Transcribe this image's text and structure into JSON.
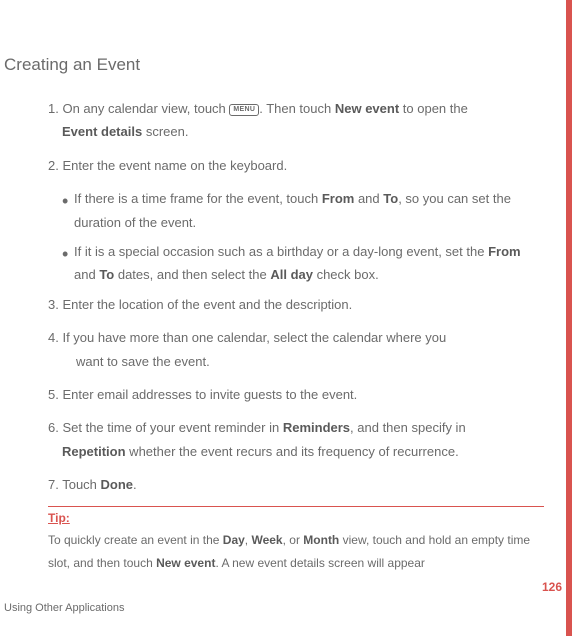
{
  "heading": "Creating an Event",
  "steps": {
    "s1_pre": "1. On any calendar view, touch ",
    "s1_menu": "MENU",
    "s1_mid": ". Then touch ",
    "s1_bold1": "New event",
    "s1_mid2": " to open the ",
    "s1_bold2": "Event details",
    "s1_end": " screen.",
    "s2": "2. Enter the event name on the keyboard.",
    "b1_pre": "If there is a time frame for the event, touch ",
    "b1_from": "From",
    "b1_and": " and ",
    "b1_to": "To",
    "b1_end": ", so you can set the duration of the event.",
    "b2_pre": "If it is a special occasion such as a birthday or a day-long event, set the ",
    "b2_from": "From",
    "b2_and": " and ",
    "b2_to": "To",
    "b2_mid": " dates, and then select the ",
    "b2_allday": "All day",
    "b2_end": " check box.",
    "s3": "3. Enter the location of the event and the description.",
    "s4_a": "4. If you have more than one calendar, select the calendar where you",
    "s4_b": "want to save the event.",
    "s5": "5. Enter email addresses to invite guests to the event.",
    "s6_pre": "6. Set the time of your event reminder in ",
    "s6_rem": "Reminders",
    "s6_mid": ", and then specify in ",
    "s6_rep": "Repetition",
    "s6_end": " whether the event recurs and its frequency of recurrence.",
    "s7_pre": "7. Touch ",
    "s7_done": "Done",
    "s7_end": "."
  },
  "tip": {
    "label": "Tip:",
    "body_pre": "To quickly create an event in the ",
    "day": "Day",
    "c1": ", ",
    "week": "Week",
    "c2": ", or ",
    "month": "Month",
    "mid": " view, touch and hold an empty time slot, and then touch ",
    "newevent": "New event",
    "end": ". A new event details screen will appear"
  },
  "page_number": "126",
  "footer": "Using Other Applications"
}
